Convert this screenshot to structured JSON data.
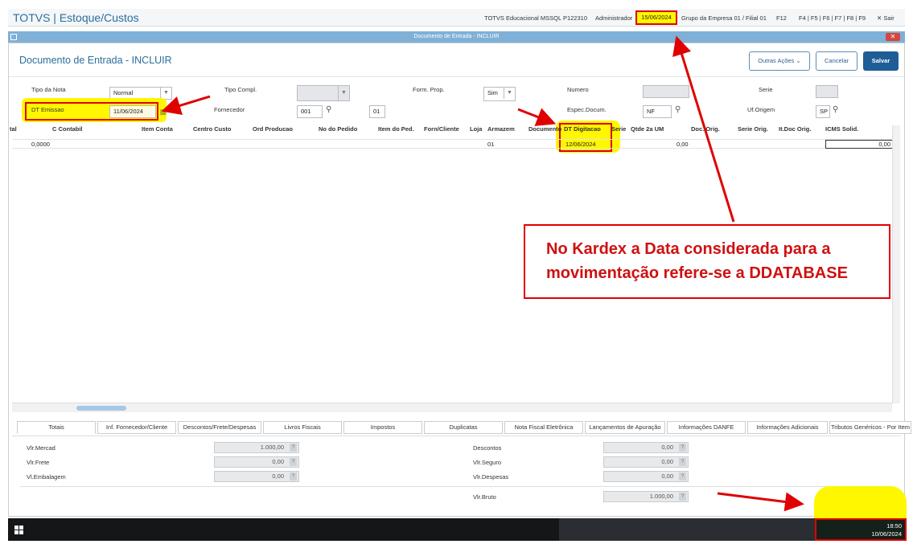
{
  "topbar": {
    "app_title": "TOTVS | Estoque/Custos",
    "environment": "TOTVS Educacional MSSQL P122310",
    "user": "Administrador",
    "database_date": "15/06/2024",
    "company": "Grupo da Empresa 01 / Filial 01",
    "f12": "F12",
    "fkeys": "F4 | F5 | F6 | F7 | F8 | F9",
    "exit": "Sair"
  },
  "window": {
    "title": "Documento de Entrada - INCLUIR",
    "page_title": "Documento de Entrada - INCLUIR",
    "buttons": {
      "outras_acoes": "Outras Ações",
      "cancelar": "Cancelar",
      "salvar": "Salvar"
    }
  },
  "form": {
    "tipo_nota": {
      "label": "Tipo da Nota",
      "value": "Normal"
    },
    "tipo_compl": {
      "label": "Tipo Compl.",
      "value": ""
    },
    "form_prop": {
      "label": "Form. Prop.",
      "value": "Sim"
    },
    "numero": {
      "label": "Numero",
      "value": ""
    },
    "serie": {
      "label": "Serie",
      "value": ""
    },
    "dt_emissao": {
      "label": "DT Emissao",
      "value": "11/06/2024"
    },
    "fornecedor": {
      "label": "Fornecedor",
      "code": "001",
      "loja": "01"
    },
    "espec_docum": {
      "label": "Espec.Docum.",
      "value": "NF"
    },
    "uf_origem": {
      "label": "Uf.Origem",
      "value": "SP"
    }
  },
  "grid": {
    "columns": [
      "tal",
      "C Contabil",
      "Item Conta",
      "Centro Custo",
      "Ord Producao",
      "No do Pedido",
      "Item do Ped.",
      "Forn/Cliente",
      "Loja",
      "Armazem",
      "Documento",
      "DT Digitacao",
      "Serie",
      "Qtde 2a UM",
      "Doc. Orig.",
      "Serie Orig.",
      "It.Doc Orig.",
      "ICMS Solid."
    ],
    "row": {
      "tal": "0,0000",
      "armazem": "01",
      "dt_digitacao": "12/06/2024",
      "qtde_2a_um": "0,00",
      "icms_solid": "0,00"
    }
  },
  "tabs": [
    "Totais",
    "Inf. Fornecedor/Cliente",
    "Descontos/Frete/Despesas",
    "Livros Fiscais",
    "Impostos",
    "Duplicatas",
    "Nota Fiscal Eletrônica",
    "Lançamentos de Apuração",
    "Informações DANFE",
    "Informações Adicionais",
    "Tributos Genéricos - Por Item"
  ],
  "totals": {
    "vlr_mercad": {
      "label": "Vlr.Mercad",
      "value": "1.000,00"
    },
    "vlr_frete": {
      "label": "Vlr.Frete",
      "value": "0,00"
    },
    "vl_embalagem": {
      "label": "Vl.Embalagem",
      "value": "0,00"
    },
    "descontos": {
      "label": "Descontos",
      "value": "0,00"
    },
    "vlr_seguro": {
      "label": "Vlr.Seguro",
      "value": "0,00"
    },
    "vlr_despesas": {
      "label": "Vlr.Despesas",
      "value": "0,00"
    },
    "vlr_bruto": {
      "label": "Vlr.Bruto",
      "value": "1.000,00"
    },
    "help": "?"
  },
  "annotation": {
    "line1": "No Kardex a Data considerada para a",
    "line2": "movimentação refere-se a DDATABASE"
  },
  "taskbar": {
    "time": "18:50",
    "date": "10/06/2024"
  },
  "colors": {
    "highlight": "#fff700",
    "annotation_red": "#e00000",
    "title_blue": "#2b6e9c"
  }
}
